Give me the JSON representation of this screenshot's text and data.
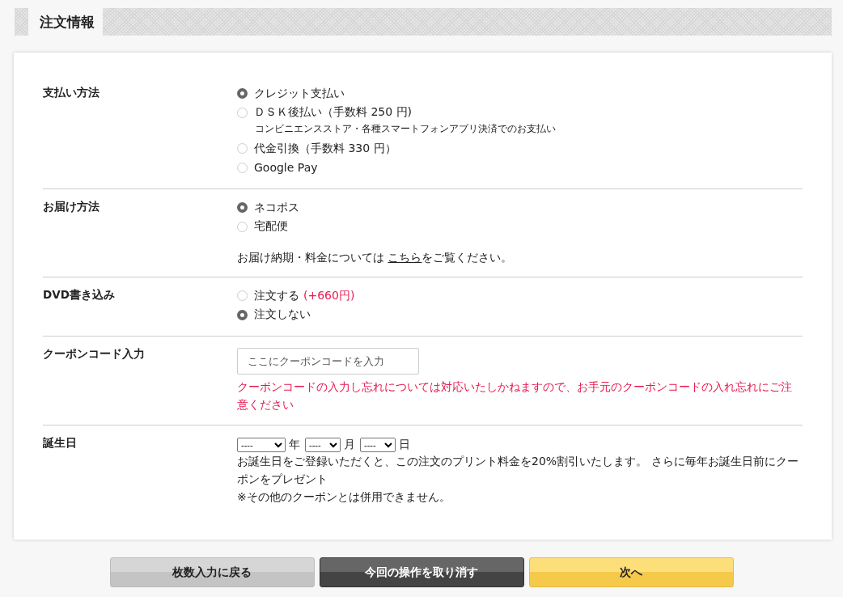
{
  "header": {
    "title": "注文情報"
  },
  "sections": [
    {
      "kind": "radio",
      "label": "支払い方法",
      "options": [
        {
          "label": "クレジット支払い",
          "selected": true
        },
        {
          "label": "ＤＳＫ後払い（手数料 250 円)",
          "note": "コンビニエンスストア・各種スマートフォンアプリ決済でのお支払い",
          "selected": false
        },
        {
          "label": "代金引換（手数料 330 円）",
          "selected": false
        },
        {
          "label": "Google Pay",
          "selected": false
        }
      ]
    },
    {
      "kind": "radio",
      "label": "お届け方法",
      "options": [
        {
          "label": "ネコポス",
          "selected": true
        },
        {
          "label": "宅配便",
          "selected": false
        }
      ],
      "info": {
        "before": "お届け納期・料金については ",
        "link": "こちら",
        "after": "をご覧ください。"
      }
    },
    {
      "kind": "radio",
      "label": "DVD書き込み",
      "options": [
        {
          "label": "注文する",
          "extra": "(+660円)",
          "selected": false
        },
        {
          "label": "注文しない",
          "selected": true
        }
      ]
    },
    {
      "kind": "coupon",
      "label": "クーポンコード入力",
      "placeholder": "ここにクーポンコードを入力",
      "warning": "クーポンコードの入力し忘れについては対応いたしかねますので、お手元のクーポンコードの入れ忘れにご注意ください"
    },
    {
      "kind": "birthday",
      "label": "誕生日",
      "selects": [
        {
          "value": "----",
          "unit": "年"
        },
        {
          "value": "----",
          "unit": "月"
        },
        {
          "value": "----",
          "unit": "日"
        }
      ],
      "notes": [
        "お誕生日をご登録いただくと、この注文のプリント料金を20%割引いたします。 さらに毎年お誕生日前にクーポンをプレゼント",
        "※その他のクーポンとは併用できません。"
      ]
    }
  ],
  "buttons": [
    {
      "kind": "back",
      "label": "枚数入力に戻る"
    },
    {
      "kind": "cancel",
      "label": "今回の操作を取り消す"
    },
    {
      "kind": "next",
      "label": "次へ"
    }
  ]
}
